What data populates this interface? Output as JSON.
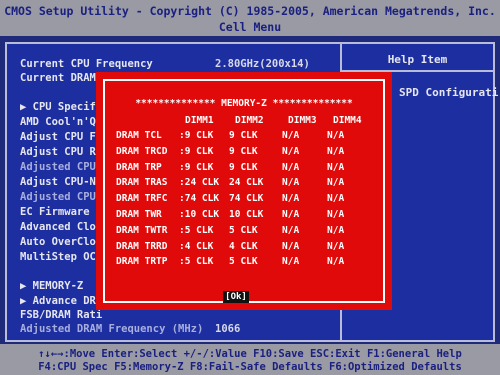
{
  "header": {
    "title": "CMOS Setup Utility - Copyright (C) 1985-2005, American Megatrends, Inc.",
    "menu": "Cell Menu"
  },
  "help": {
    "title": "Help Item",
    "text": "SPD Configurati"
  },
  "settings": [
    {
      "label": "Current CPU Frequency",
      "value": "2.80GHz(200x14)"
    },
    {
      "label": "Current DRAM",
      "value": ""
    },
    {
      "label": "▶ CPU Specifi",
      "value": ""
    },
    {
      "label": "AMD Cool'n'Qu",
      "value": ""
    },
    {
      "label": "Adjust CPU FS",
      "value": ""
    },
    {
      "label": "Adjust CPU Ra",
      "value": ""
    },
    {
      "label": "Adjusted CPU",
      "value": ""
    },
    {
      "label": "Adjust CPU-NB",
      "value": ""
    },
    {
      "label": "Adjusted CPU-",
      "value": ""
    },
    {
      "label": "EC Firmware",
      "value": ""
    },
    {
      "label": "Advanced Cloc",
      "value": ""
    },
    {
      "label": "Auto OverCloc",
      "value": ""
    },
    {
      "label": "MultiStep OC",
      "value": ""
    },
    {
      "label": "▶ MEMORY-Z",
      "value": ""
    },
    {
      "label": "▶ Advance DRA",
      "value": ""
    },
    {
      "label": "FSB/DRAM Rati",
      "value": ""
    },
    {
      "label": "Adjusted DRAM Frequency (MHz)",
      "value": "1066"
    }
  ],
  "dialog": {
    "title": "************** MEMORY-Z **************",
    "columns": [
      "DIMM1",
      "DIMM2",
      "DIMM3",
      "DIMM4"
    ],
    "rows": [
      {
        "label": "DRAM TCL",
        "values": [
          ":9 CLK",
          "9 CLK",
          "N/A",
          "N/A"
        ]
      },
      {
        "label": "DRAM TRCD",
        "values": [
          ":9 CLK",
          "9 CLK",
          "N/A",
          "N/A"
        ]
      },
      {
        "label": "DRAM TRP",
        "values": [
          ":9 CLK",
          "9 CLK",
          "N/A",
          "N/A"
        ]
      },
      {
        "label": "DRAM TRAS",
        "values": [
          ":24 CLK",
          "24 CLK",
          "N/A",
          "N/A"
        ]
      },
      {
        "label": "DRAM TRFC",
        "values": [
          ":74 CLK",
          "74 CLK",
          "N/A",
          "N/A"
        ]
      },
      {
        "label": "DRAM TWR",
        "values": [
          ":10 CLK",
          "10 CLK",
          "N/A",
          "N/A"
        ]
      },
      {
        "label": "DRAM TWTR",
        "values": [
          ":5 CLK",
          "5 CLK",
          "N/A",
          "N/A"
        ]
      },
      {
        "label": "DRAM TRRD",
        "values": [
          ":4 CLK",
          "4 CLK",
          "N/A",
          "N/A"
        ]
      },
      {
        "label": "DRAM TRTP",
        "values": [
          ":5 CLK",
          "5 CLK",
          "N/A",
          "N/A"
        ]
      }
    ],
    "ok_label": "[Ok]"
  },
  "footer": {
    "line1": "↑↓←→:Move  Enter:Select  +/-/:Value  F10:Save  ESC:Exit  F1:General Help",
    "line2": "F4:CPU Spec  F5:Memory-Z  F8:Fail-Safe Defaults  F6:Optimized Defaults"
  },
  "colors": {
    "background": "#1f2a7a",
    "panel": "#1d2fa0",
    "dialog": "#e00a0a",
    "bar": "#9a9aa4",
    "bar_text": "#1a2080"
  }
}
